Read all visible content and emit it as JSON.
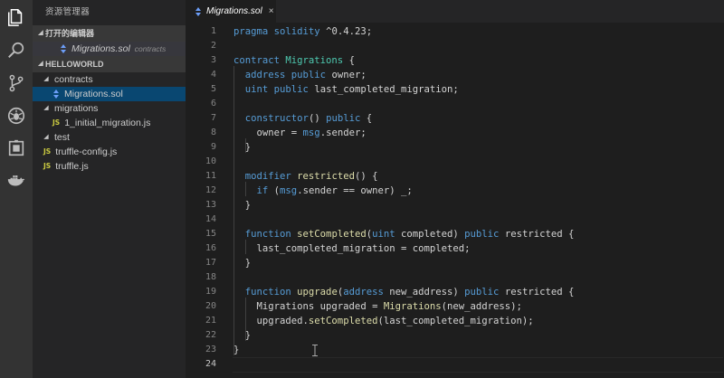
{
  "activity_bar": {
    "icons": [
      "files-icon",
      "search-icon",
      "source-control-icon",
      "debug-icon",
      "extensions-icon",
      "docker-icon"
    ]
  },
  "sidebar": {
    "title": "资源管理器",
    "open_editors": {
      "header": "打开的编辑器",
      "items": [
        {
          "name": "Migrations.sol",
          "folder": "contracts"
        }
      ]
    },
    "project": {
      "header": "HELLOWORLD",
      "tree": [
        {
          "label": "contracts",
          "type": "folder"
        },
        {
          "label": "Migrations.sol",
          "type": "sol"
        },
        {
          "label": "migrations",
          "type": "folder"
        },
        {
          "label": "1_initial_migration.js",
          "type": "js"
        },
        {
          "label": "test",
          "type": "folder"
        },
        {
          "label": "truffle-config.js",
          "type": "js"
        },
        {
          "label": "truffle.js",
          "type": "js"
        }
      ]
    }
  },
  "tabs": [
    {
      "label": "Migrations.sol",
      "close": "×"
    }
  ],
  "editor": {
    "current_line": 24,
    "code": [
      [
        [
          "pragma solidity ",
          "kw"
        ],
        [
          "^0.4.23;",
          ""
        ]
      ],
      [],
      [
        [
          "contract ",
          "kw"
        ],
        [
          "Migrations",
          "ty"
        ],
        [
          " {",
          ""
        ]
      ],
      [
        [
          "  ",
          ""
        ],
        [
          "address ",
          "kw"
        ],
        [
          "public ",
          "kw"
        ],
        [
          "owner;",
          ""
        ]
      ],
      [
        [
          "  ",
          ""
        ],
        [
          "uint ",
          "kw"
        ],
        [
          "public ",
          "kw"
        ],
        [
          "last_completed_migration;",
          ""
        ]
      ],
      [],
      [
        [
          "  ",
          ""
        ],
        [
          "constructor",
          "kw"
        ],
        [
          "() ",
          ""
        ],
        [
          "public",
          "kw"
        ],
        [
          " {",
          ""
        ]
      ],
      [
        [
          "    owner = ",
          ""
        ],
        [
          "msg",
          "kw"
        ],
        [
          ".sender;",
          ""
        ]
      ],
      [
        [
          "  }",
          ""
        ]
      ],
      [],
      [
        [
          "  ",
          ""
        ],
        [
          "modifier ",
          "kw"
        ],
        [
          "restricted",
          "fn"
        ],
        [
          "() {",
          ""
        ]
      ],
      [
        [
          "    ",
          ""
        ],
        [
          "if",
          "kw"
        ],
        [
          " (",
          ""
        ],
        [
          "msg",
          "kw"
        ],
        [
          ".sender == owner) _;",
          ""
        ]
      ],
      [
        [
          "  }",
          ""
        ]
      ],
      [],
      [
        [
          "  ",
          ""
        ],
        [
          "function ",
          "kw"
        ],
        [
          "setCompleted",
          "fn"
        ],
        [
          "(",
          ""
        ],
        [
          "uint",
          "kw"
        ],
        [
          " completed) ",
          ""
        ],
        [
          "public",
          "kw"
        ],
        [
          " restricted {",
          ""
        ]
      ],
      [
        [
          "    last_completed_migration = completed;",
          ""
        ]
      ],
      [
        [
          "  }",
          ""
        ]
      ],
      [],
      [
        [
          "  ",
          ""
        ],
        [
          "function ",
          "kw"
        ],
        [
          "upgrade",
          "fn"
        ],
        [
          "(",
          ""
        ],
        [
          "address",
          "kw"
        ],
        [
          " new_address) ",
          ""
        ],
        [
          "public",
          "kw"
        ],
        [
          " restricted {",
          ""
        ]
      ],
      [
        [
          "    Migrations upgraded = ",
          ""
        ],
        [
          "Migrations",
          "fn"
        ],
        [
          "(new_address);",
          ""
        ]
      ],
      [
        [
          "    upgraded.",
          ""
        ],
        [
          "setCompleted",
          "fn"
        ],
        [
          "(last_completed_migration);",
          ""
        ]
      ],
      [
        [
          "  }",
          ""
        ]
      ],
      [
        [
          "}",
          ""
        ]
      ],
      []
    ]
  }
}
